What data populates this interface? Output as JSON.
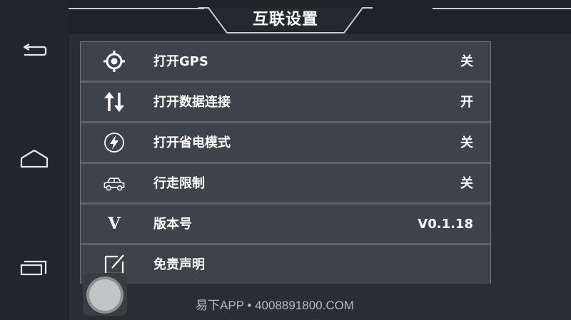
{
  "header": {
    "title": "互联设置"
  },
  "nav": {
    "items": [
      {
        "name": "back",
        "icon": "back-arrow-icon"
      },
      {
        "name": "home",
        "icon": "home-icon"
      },
      {
        "name": "recent-apps",
        "icon": "recent-apps-icon"
      }
    ]
  },
  "settings": {
    "rows": [
      {
        "label": "打开GPS",
        "value": "关",
        "icon": "gps-target-icon"
      },
      {
        "label": "打开数据连接",
        "value": "开",
        "icon": "data-transfer-arrows-icon"
      },
      {
        "label": "打开省电模式",
        "value": "关",
        "icon": "power-saving-bolt-icon"
      },
      {
        "label": "行走限制",
        "value": "关",
        "icon": "car-icon"
      },
      {
        "label": "版本号",
        "value": "V0.1.18",
        "icon": "version-v-icon",
        "icon_text": "V"
      },
      {
        "label": "免责声明",
        "value": "",
        "icon": "edit-note-icon"
      }
    ]
  },
  "watermark": "易下APP • 4008891800.COM",
  "colors": {
    "background": "#2a2d33",
    "row": "#3e4249",
    "row_separator": "#5d6168",
    "text": "#ffffff"
  }
}
